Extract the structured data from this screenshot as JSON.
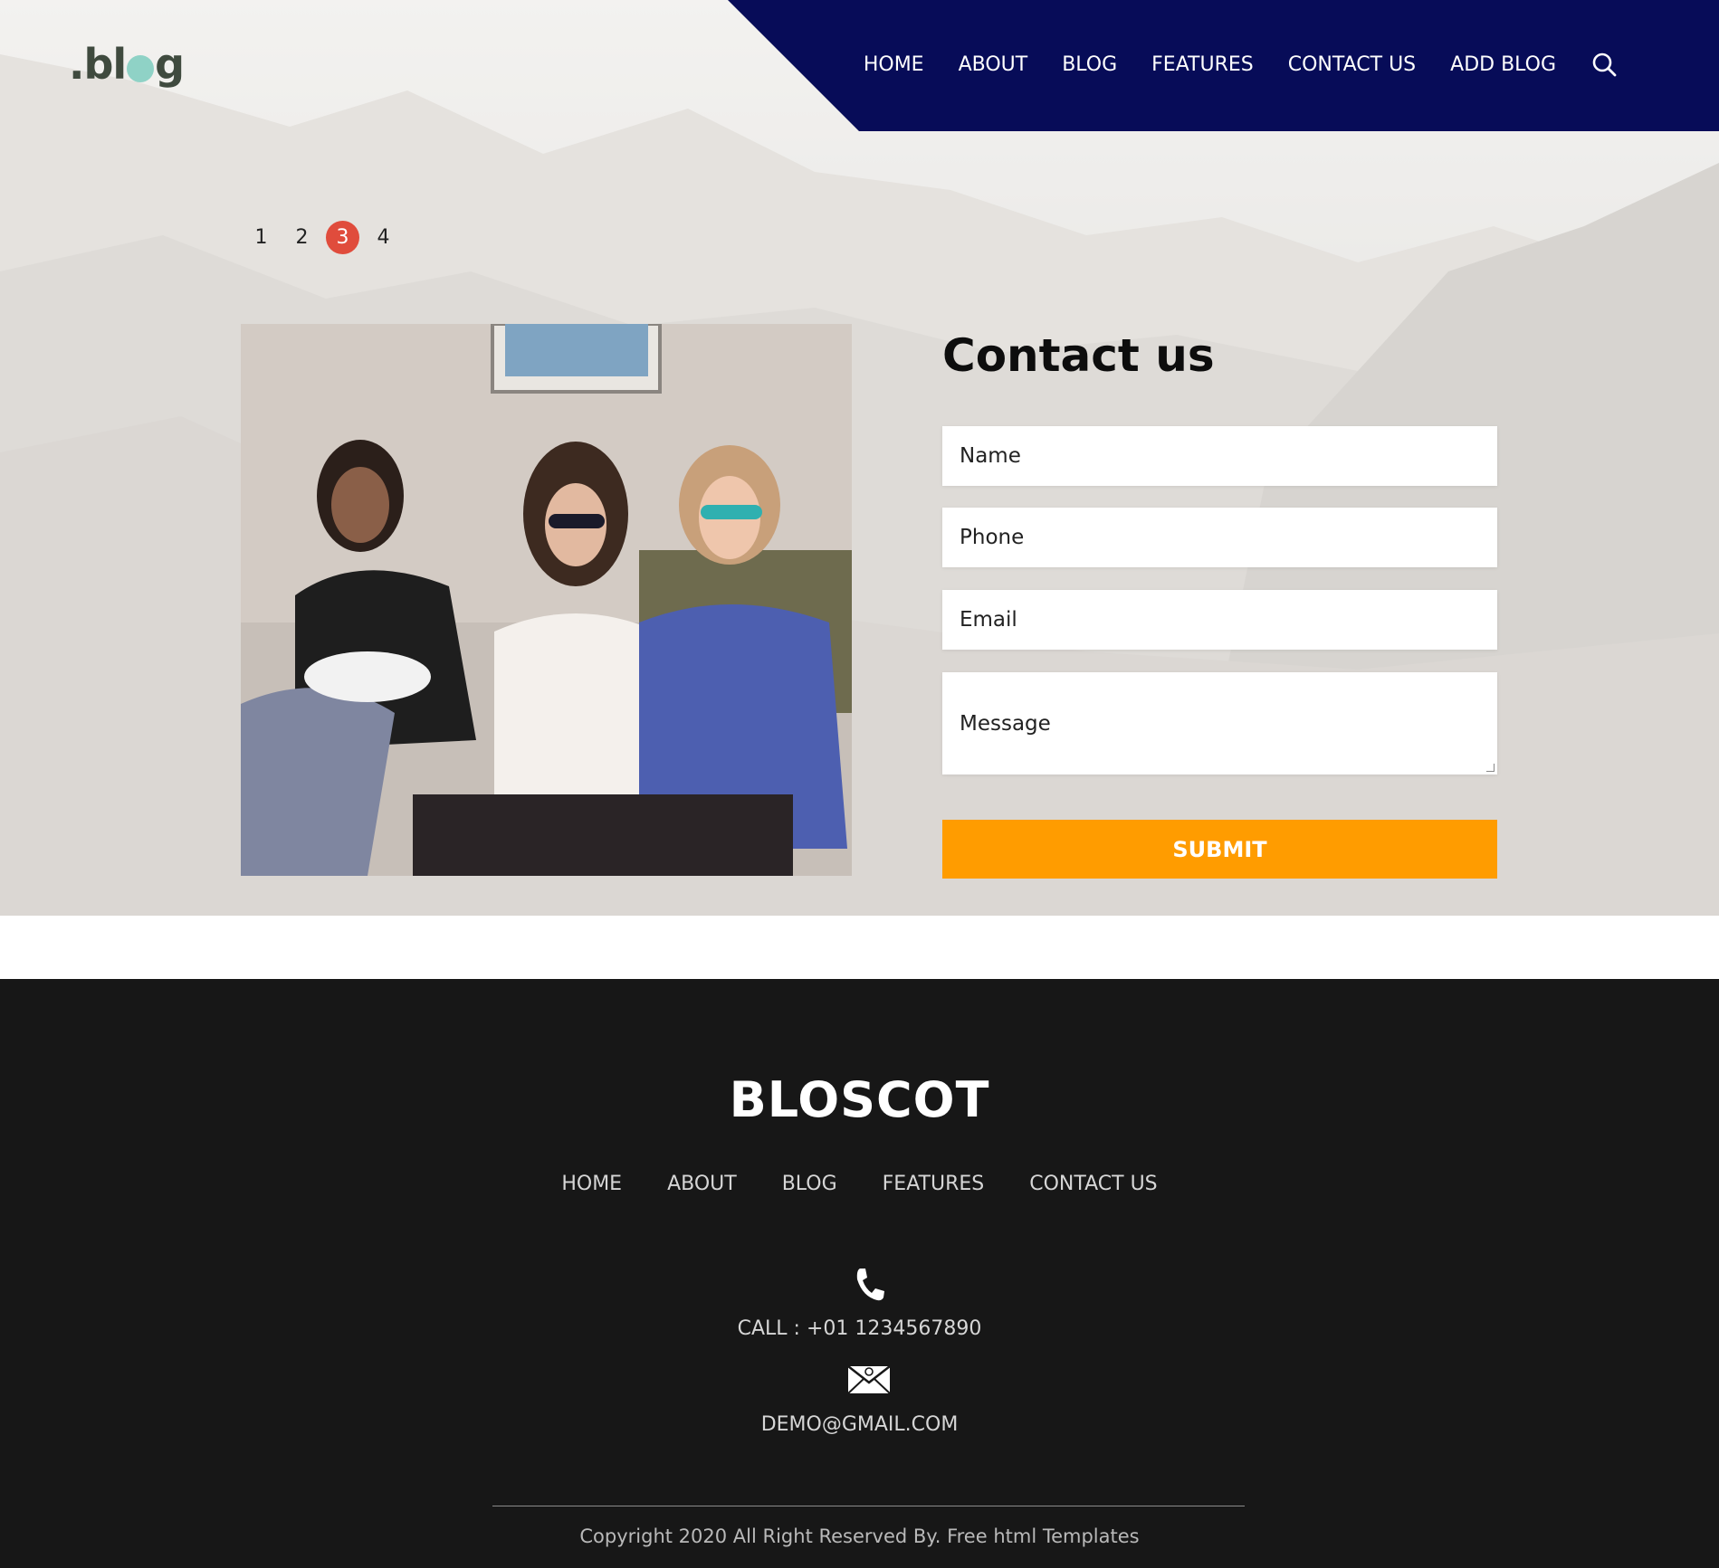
{
  "header": {
    "logo": {
      "pre": ".bl",
      "post": "g"
    },
    "nav": [
      "HOME",
      "ABOUT",
      "BLOG",
      "FEATURES",
      "CONTACT US",
      "ADD BLOG"
    ],
    "search_icon": "search-icon"
  },
  "pager": {
    "pages": [
      "1",
      "2",
      "3",
      "4"
    ],
    "active": "3"
  },
  "contact": {
    "title": "Contact us",
    "name_placeholder": "Name",
    "phone_placeholder": "Phone",
    "email_placeholder": "Email",
    "message_placeholder": "Message",
    "submit_label": "SUBMIT"
  },
  "footer": {
    "brand": "BLOSCOT",
    "nav": [
      "HOME",
      "ABOUT",
      "BLOG",
      "FEATURES",
      "CONTACT US"
    ],
    "call": "CALL : +01 1234567890",
    "email": "DEMO@GMAIL.COM",
    "copyright": "Copyright 2020 All Right Reserved By. Free html Templates"
  },
  "colors": {
    "nav_bg": "#070c58",
    "submit_bg": "#ff9c00",
    "pager_active": "#e04c3c",
    "footer_bg": "#171717",
    "logo_dot": "#8fd2c6"
  }
}
